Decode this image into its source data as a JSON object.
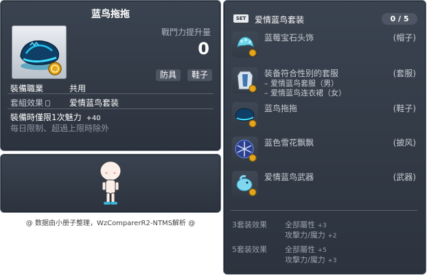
{
  "item_code": "01073088",
  "item": {
    "name": "蓝鸟拖拖",
    "power_label": "戰鬥力提升量",
    "power_value": "0",
    "tag_type": "防具",
    "tag_subtype": "鞋子",
    "job_label": "裝備職業",
    "job_value": "共用",
    "set_effect_label": "套組效果",
    "set_effect_value": "爱情蓝鸟套装",
    "limit_text": "裝備時僅限1次魅力",
    "limit_value": "+40",
    "limit_note": "每日限制、超過上限時除外"
  },
  "credit": "@ 数据由小册子整理，WzComparerR2-NTMS解析 @",
  "set": {
    "badge": "SET",
    "name": "爱情蓝鸟套装",
    "count": "0 / 5",
    "items": [
      {
        "name": "蓝莓宝石头饰",
        "type": "(帽子)",
        "icon": "gem-headpiece-icon"
      },
      {
        "name": "装备符合性别的套服",
        "type": "(套服)",
        "icon": "outfit-icon",
        "subs": [
          "– 爱情蓝鸟套服（男）",
          "– 爱情蓝鸟连衣裙（女）"
        ]
      },
      {
        "name": "蓝鸟拖拖",
        "type": "(鞋子)",
        "icon": "shoe-icon"
      },
      {
        "name": "蓝色雪花飘飘",
        "type": "(披风)",
        "icon": "snowflake-cape-icon"
      },
      {
        "name": "爱情蓝鸟武器",
        "type": "(武器)",
        "icon": "bird-weapon-icon"
      }
    ],
    "effects": [
      {
        "label": "3套装效果",
        "lines": [
          {
            "name": "全部屬性",
            "value": "+3"
          },
          {
            "name": "攻擊力/魔力",
            "value": "+2"
          }
        ]
      },
      {
        "label": "5套装效果",
        "lines": [
          {
            "name": "全部屬性",
            "value": "+5"
          },
          {
            "name": "攻擊力/魔力",
            "value": "+3"
          }
        ]
      }
    ]
  }
}
